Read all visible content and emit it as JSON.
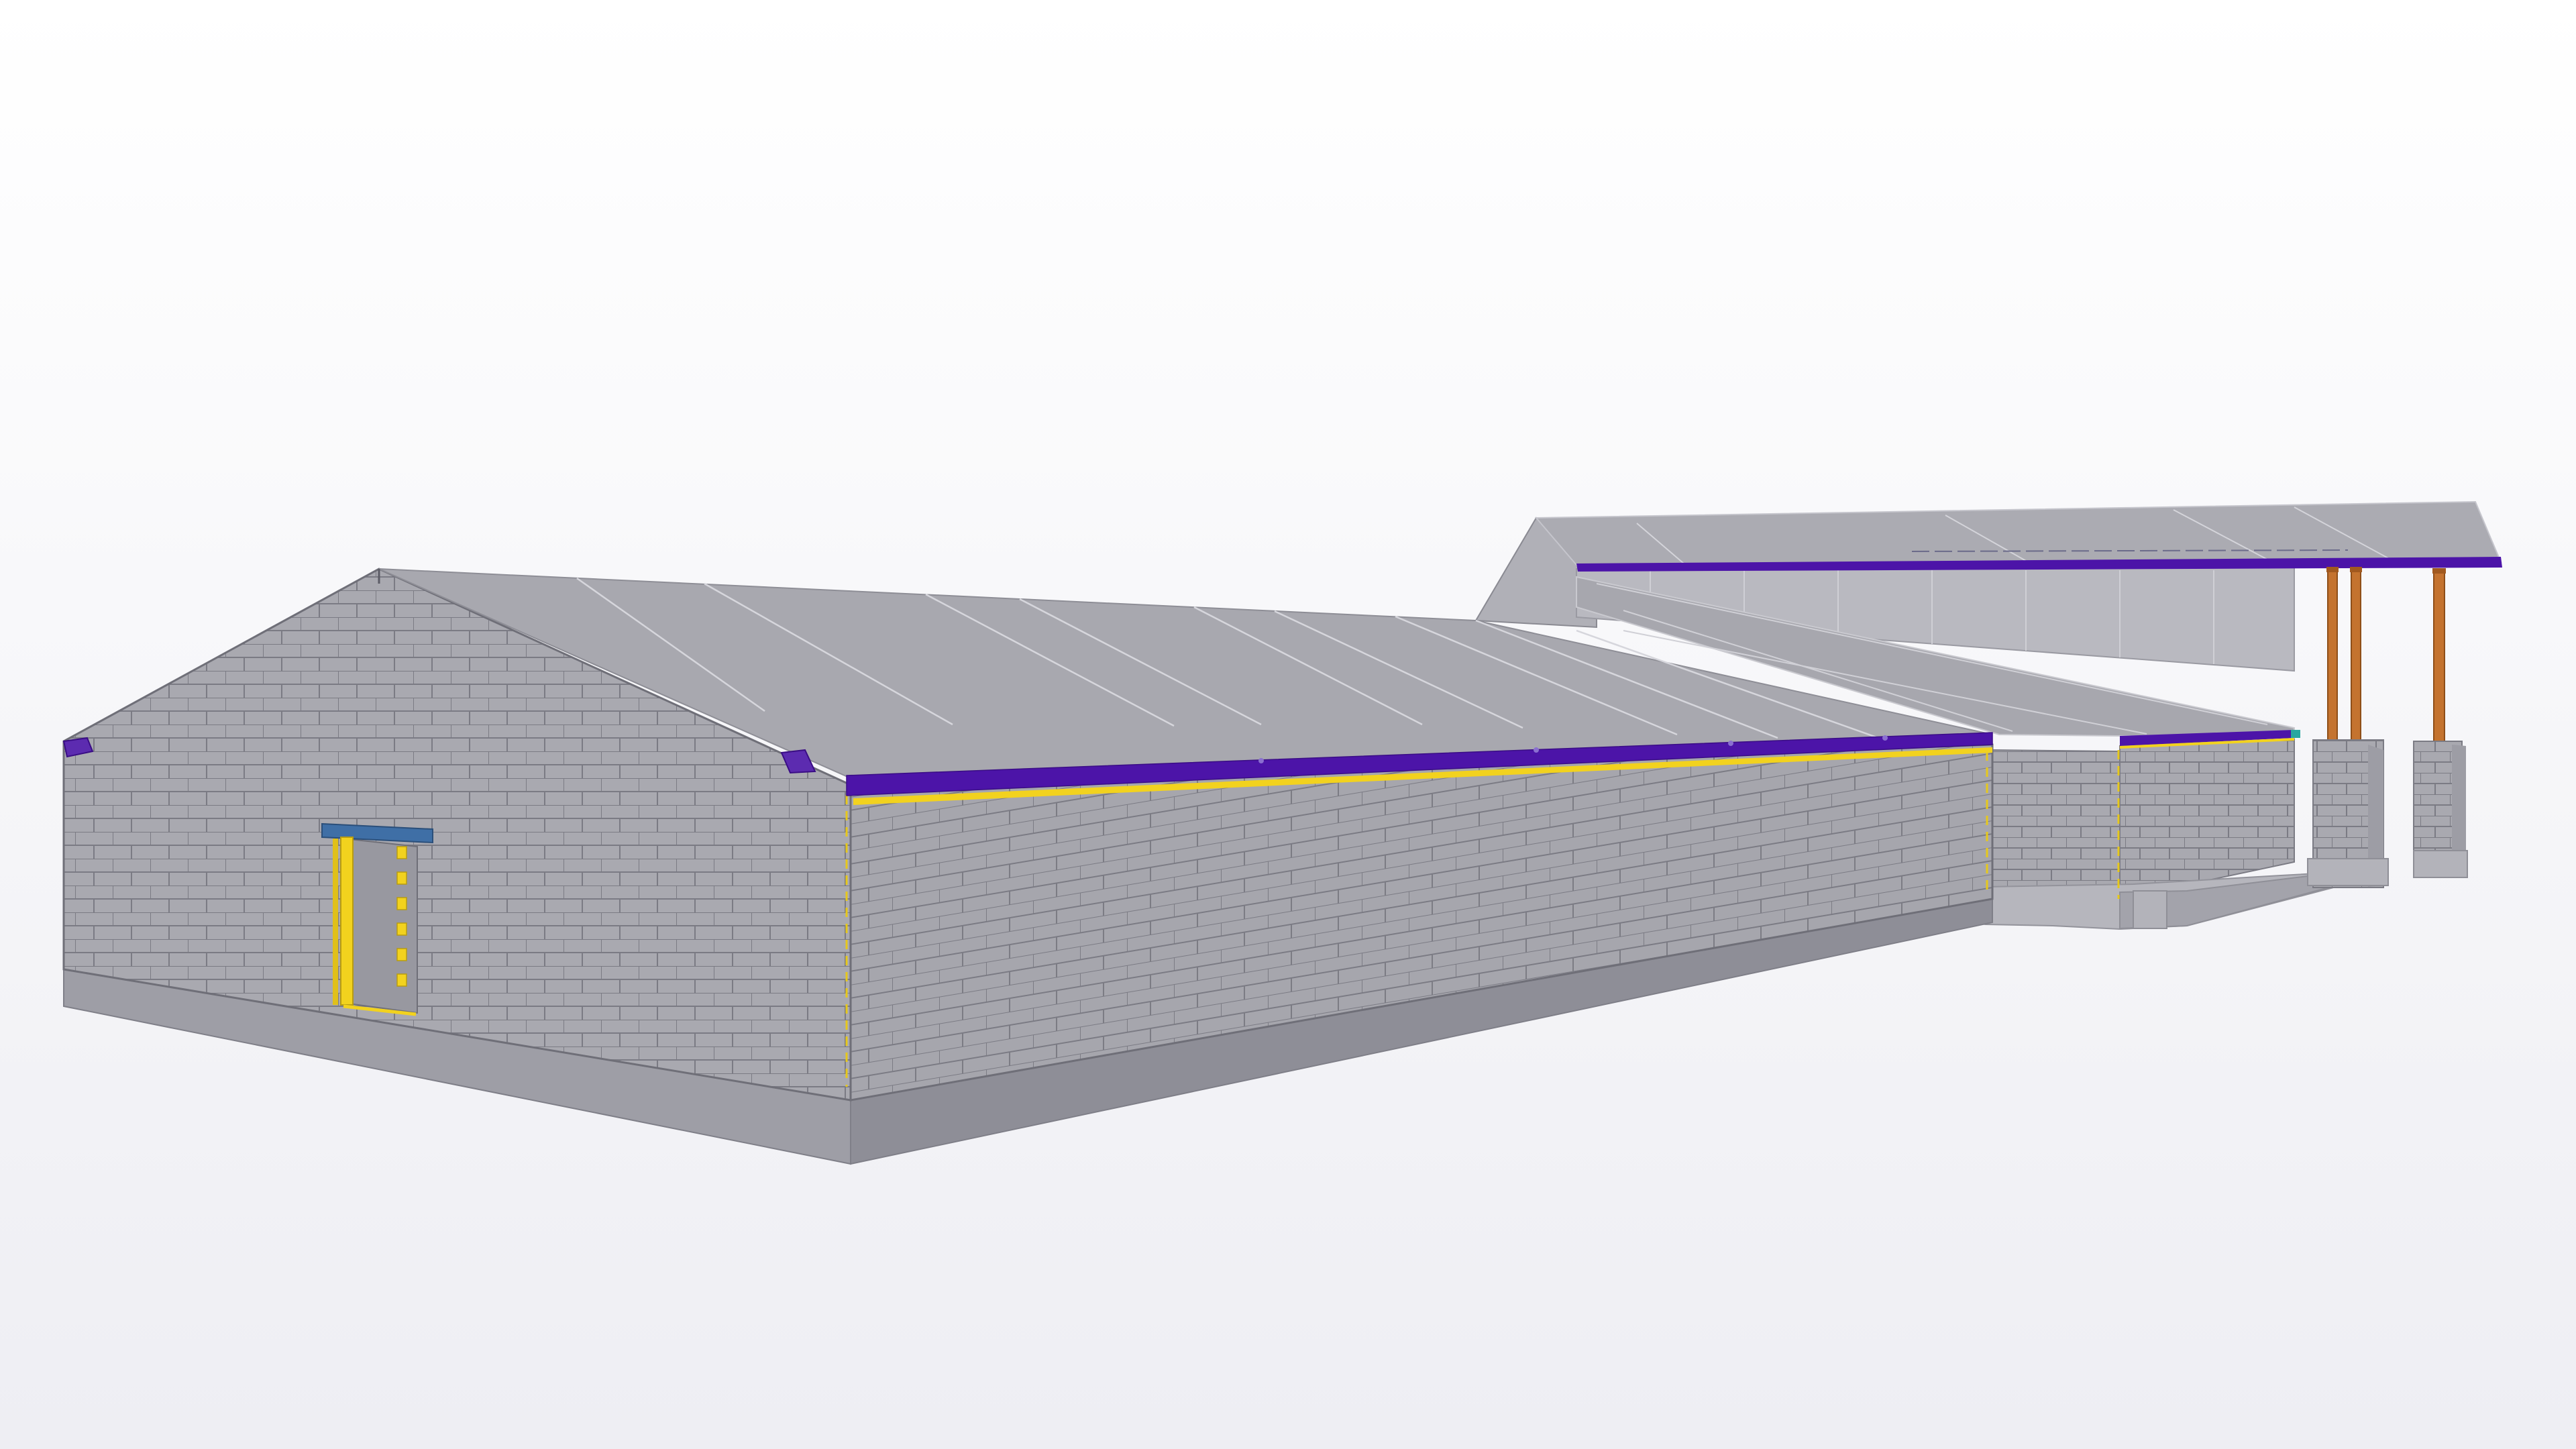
{
  "viewer": {
    "background_top": "#ffffff",
    "background_bottom": "#eeeef3"
  },
  "colors": {
    "masonry_wall": "#a9a9b0",
    "masonry_wall_shade": "#9b9ba3",
    "block_joint": "#7b7b84",
    "foundation_front": "#8e8e97",
    "foundation_side": "#a3a3ab",
    "roof_face": "#a8a8af",
    "roof_edge_line": "#d4d4da",
    "fascia_beam": "#4c14a8",
    "wall_plate": "#f2d21e",
    "door_lintel": "#3f6fa6",
    "door_frame": "#f2d21e",
    "porch_column": "#c4732f",
    "porch_slab": "#b4b4bb"
  },
  "model": {
    "elements": [
      "gable-end-wall",
      "long-side-wall",
      "main-roof",
      "annex-wall",
      "annex-roof",
      "porch-roof",
      "porch-columns",
      "masonry-piers",
      "porch-slab",
      "foundation-plinth",
      "doorway"
    ]
  }
}
